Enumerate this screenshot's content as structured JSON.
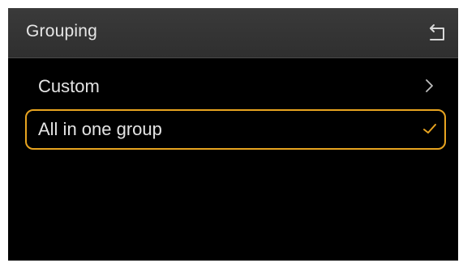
{
  "header": {
    "title": "Grouping",
    "back_icon": "back-arrow-icon"
  },
  "options": [
    {
      "label": "Custom",
      "icon": "chevron-right-icon",
      "selected": false
    },
    {
      "label": "All in one group",
      "icon": "checkmark-icon",
      "selected": true
    }
  ],
  "colors": {
    "background": "#000000",
    "header": "#333333",
    "text": "#e4e4e4",
    "accent": "#e8a420"
  }
}
